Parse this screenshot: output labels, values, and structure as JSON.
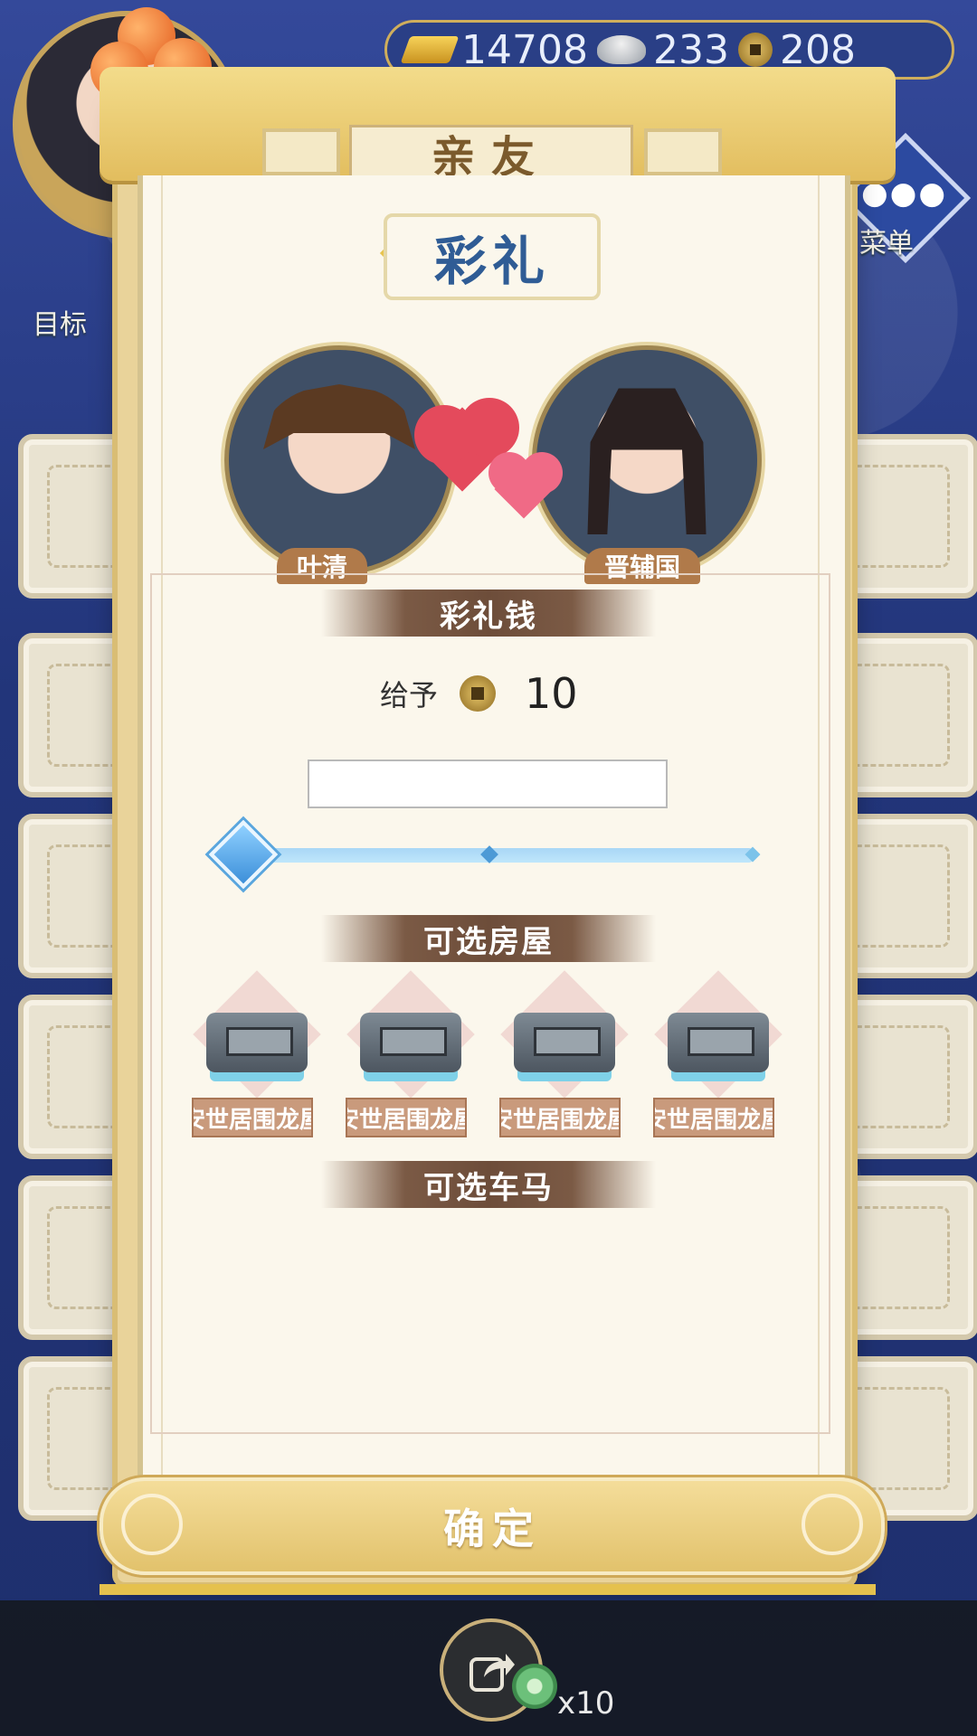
{
  "currency": {
    "gold": "14708",
    "silver": "233",
    "coins": "208"
  },
  "side": {
    "target_label": "目标",
    "menu_label": "菜单"
  },
  "modal": {
    "tab_title": "亲友",
    "heading": "彩礼",
    "bride_name": "叶清",
    "groom_name": "晋辅国",
    "money_section": "彩礼钱",
    "give_label": "给予",
    "give_value": "10",
    "amount_input_value": "",
    "slider_fraction": 0,
    "houses_section": "可选房屋",
    "houses": [
      {
        "label": "安世居围龙屋"
      },
      {
        "label": "安世居围龙屋"
      },
      {
        "label": "安世居围龙屋"
      },
      {
        "label": "安世居围龙屋"
      }
    ],
    "carriages_section": "可选车马",
    "confirm_label": "确定"
  },
  "bottom": {
    "share_icon": "share-icon",
    "jade_count": "x10"
  },
  "colors": {
    "heading_blue": "#2f5c95",
    "section_brown": "#6d4d3a",
    "gold_accent": "#e2c26c"
  }
}
